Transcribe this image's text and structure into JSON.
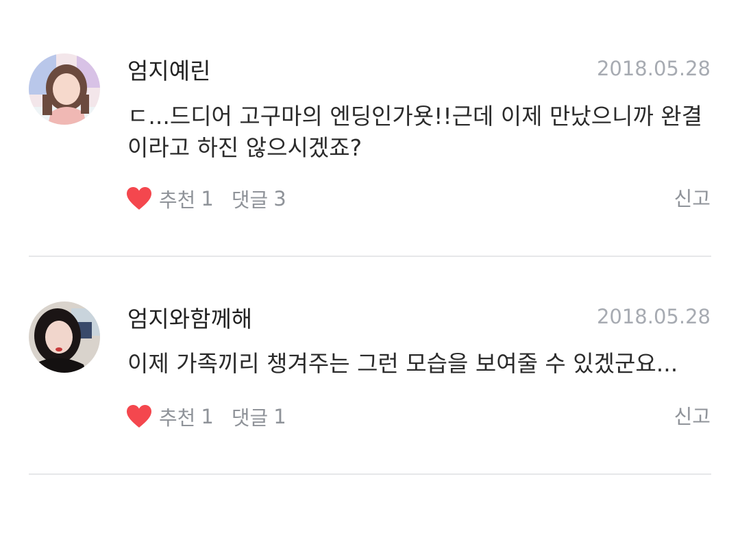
{
  "comments": [
    {
      "username": "엄지예린",
      "date": "2018.05.28",
      "body": "ㄷ...드디어 고구마의 엔딩인가욧!!근데 이제 만났으니까 완결이라고 하진 않으시겠죠?",
      "like_label": "추천",
      "like_count": "1",
      "reply_label": "댓글",
      "reply_count": "3",
      "report_label": "신고"
    },
    {
      "username": "엄지와함께해",
      "date": "2018.05.28",
      "body": "이제 가족끼리 챙겨주는 그런 모습을 보여줄 수 있겠군요...",
      "like_label": "추천",
      "like_count": "1",
      "reply_label": "댓글",
      "reply_count": "1",
      "report_label": "신고"
    }
  ],
  "colors": {
    "heart": "#f4474e",
    "date": "#a7abb2",
    "meta": "#8f9399",
    "divider": "#e6e7e9"
  },
  "icons": {
    "like": "heart-icon"
  }
}
